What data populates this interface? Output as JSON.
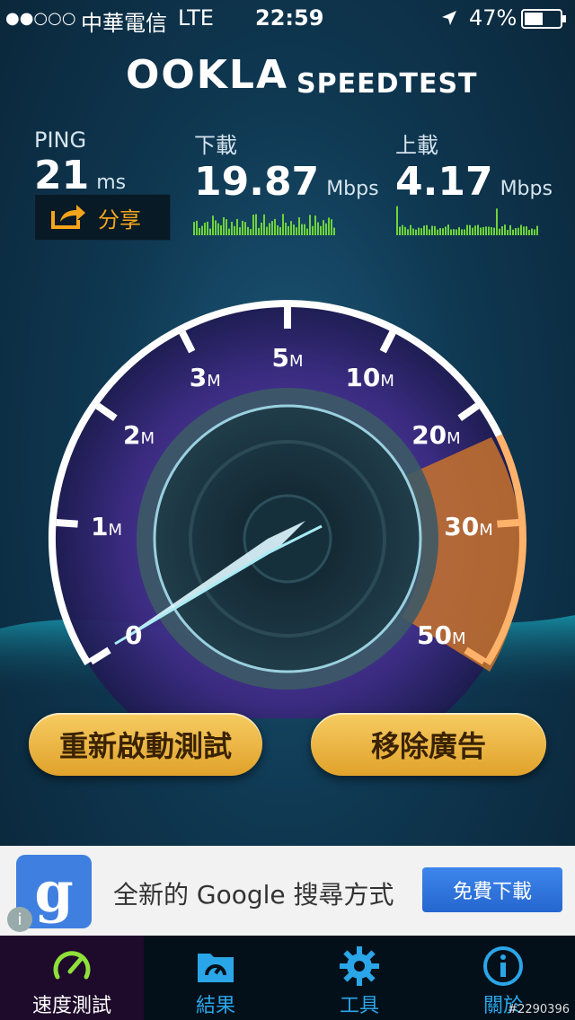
{
  "status_bar": {
    "signal": "●●○○○",
    "carrier": "中華電信",
    "network": "LTE",
    "time": "22:59",
    "battery": "47%"
  },
  "header": {
    "logo": "OOKLA",
    "title": "SPEEDTEST"
  },
  "metrics": {
    "ping": {
      "label": "PING",
      "value": "21",
      "unit": "ms"
    },
    "download": {
      "label": "下載",
      "value": "19.87",
      "unit": "Mbps"
    },
    "upload": {
      "label": "上載",
      "value": "4.17",
      "unit": "Mbps"
    }
  },
  "share": {
    "label": "分享"
  },
  "gauge": {
    "ticks": [
      {
        "num": "0",
        "unit": ""
      },
      {
        "num": "1",
        "unit": "M"
      },
      {
        "num": "2",
        "unit": "M"
      },
      {
        "num": "3",
        "unit": "M"
      },
      {
        "num": "5",
        "unit": "M"
      },
      {
        "num": "10",
        "unit": "M"
      },
      {
        "num": "20",
        "unit": "M"
      },
      {
        "num": "30",
        "unit": "M"
      },
      {
        "num": "50",
        "unit": "M"
      }
    ],
    "needle_value_mbps": 0
  },
  "actions": {
    "restart_label": "重新啟動測試",
    "remove_ads_label": "移除廣告"
  },
  "ad": {
    "icon_letter": "g",
    "text": "全新的 Google 搜尋方式",
    "button_label": "免費下載",
    "info": "i"
  },
  "tabs": [
    {
      "label": "速度測試",
      "icon": "speedometer-icon"
    },
    {
      "label": "結果",
      "icon": "folder-gauge-icon"
    },
    {
      "label": "工具",
      "icon": "gear-icon"
    },
    {
      "label": "關於",
      "icon": "info-icon"
    }
  ],
  "watermark": "#2290396",
  "colors": {
    "accent": "#f5a51b",
    "tab_active": "#8fe03a",
    "tab_icon": "#2aa6e8"
  }
}
